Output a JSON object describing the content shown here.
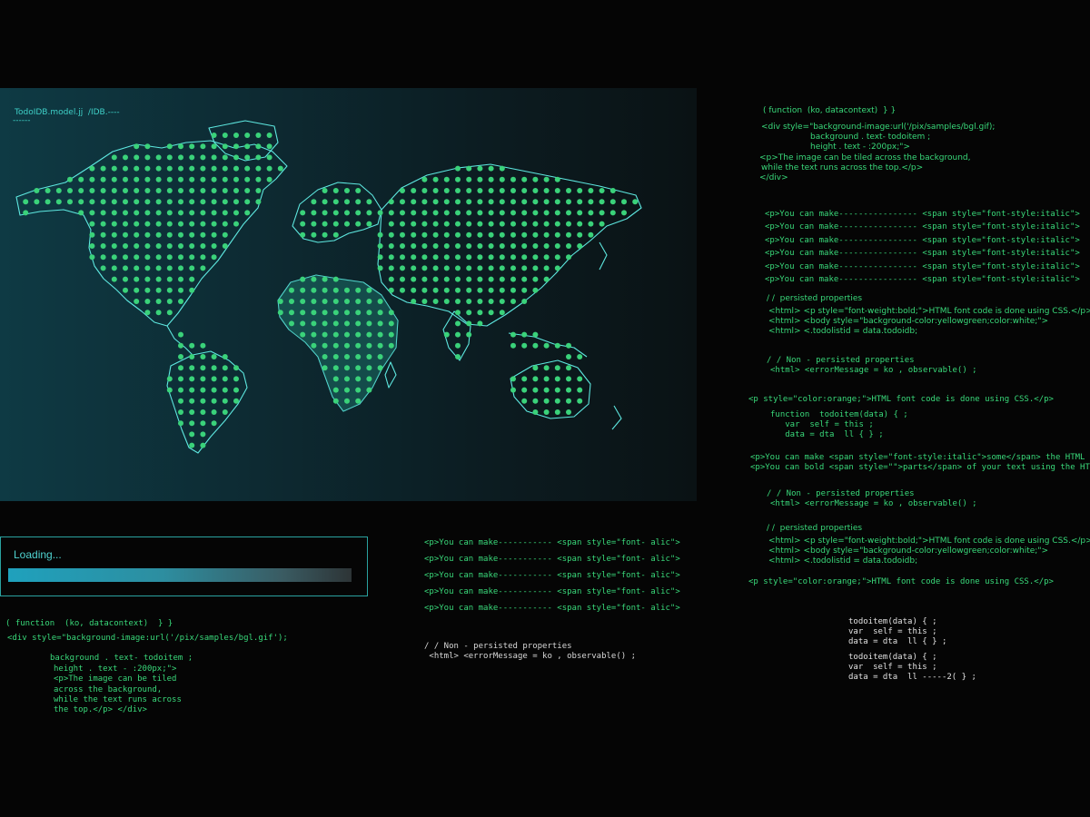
{
  "map_panel": {
    "title": "TodoIDB.model.jj  /IDB.----",
    "title_underline": "------"
  },
  "loading": {
    "label": "Loading...",
    "progress": 1.0
  },
  "colors": {
    "background": "#050505",
    "map_gradient_start": "#0e3a44",
    "map_gradient_end": "#0a1214",
    "dot_green": "#3ad27a",
    "coastline": "#5ee8e0",
    "code_green": "#39d97a",
    "code_cyan": "#3fd1c8",
    "loading_fill": "#1fa1bd"
  },
  "left_code": [
    "( function  (ko, datacontext)  } }",
    "<div style=\"background-image:url('/pix/samples/bgl.gif');",
    "background . text- todoitem ;",
    "height . text - :200px;\">",
    "<p>The image can be tiled",
    "across the background,",
    "while the text runs across",
    "the top.</p> </div>"
  ],
  "middle_code": {
    "lines": [
      "<p>You can make----------- <span style=\"font- alic\">",
      "<p>You can make----------- <span style=\"font- alic\">",
      "<p>You can make----------- <span style=\"font- alic\">",
      "<p>You can make----------- <span style=\"font- alic\">",
      "<p>You can make----------- <span style=\"font- alic\">"
    ],
    "comment": "/ / Non - persisted properties",
    "error_line": " <html> <errorMessage = ko , observable() ;"
  },
  "right_code": {
    "header": [
      "( function  (ko, datacontext)  } }",
      "<div style=\"background-image:url('/pix/samples/bgl.gif);",
      "background . text- todoitem ;",
      "height . text - :200px;\">",
      "<p>The image can be tiled across the background,",
      "while the text runs across the top.</p>",
      "</div>"
    ],
    "span_lines": [
      "<p>You can make---------------- <span style=\"font-style:italic\">",
      "<p>You can make---------------- <span style=\"font-style:italic\">",
      "<p>You can make---------------- <span style=\"font-style:italic\">",
      "<p>You can make---------------- <span style=\"font-style:italic\">",
      "<p>You can make---------------- <span style=\"font-style:italic\">",
      "<p>You can make---------------- <span style=\"font-style:italic\">"
    ],
    "persisted_a": {
      "comment": "/ /  persisted properties",
      "lines": [
        "<html> <p style=\"font-weight:bold;\">HTML font code is done using CSS.</p>",
        "<html> <body style=\"background-color:yellowgreen;color:white;\">",
        "<html> <.todolistid = data.todoidb;"
      ]
    },
    "non_persisted_a": {
      "comment": "/ / Non - persisted properties",
      "line": "<html> <errorMessage = ko , observable() ;"
    },
    "orange_a": "<p style=\"color:orange;\">HTML font code is done using CSS.</p>",
    "function_block": [
      "function  todoitem(data) { ;",
      "   var  self = this ;",
      "   data = dta  ll { } ;"
    ],
    "make_lines": [
      "<p>You can make <span style=\"font-style:italic\">some</span> the HTML 's",
      "<p>You can bold <span style=\"\">parts</span> of your text using the HTML"
    ],
    "non_persisted_b": {
      "comment": "/ / Non - persisted properties",
      "line": "<html> <errorMessage = ko , observable() ;"
    },
    "persisted_b": {
      "comment": "/ /  persisted properties",
      "lines": [
        "<html> <p style=\"font-weight:bold;\">HTML font code is done using CSS.</p>",
        "<html> <body style=\"background-color:yellowgreen;color:white;\">",
        "<html> <.todolistid = data.todoidb;"
      ]
    },
    "orange_b": "<p style=\"color:orange;\">HTML font code is done using CSS.</p>",
    "todo_block_a": [
      "todoitem(data) { ;",
      "var  self = this ;",
      "data = dta  ll { } ;"
    ],
    "todo_block_b": [
      "todoitem(data) { ;",
      "var  self = this ;",
      "data = dta  ll -----2( } ;"
    ]
  }
}
